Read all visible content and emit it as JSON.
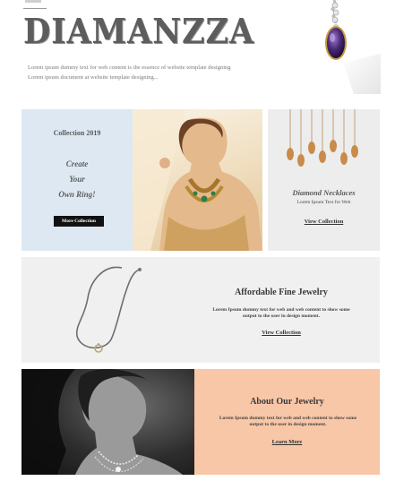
{
  "brand": {
    "logo_text": "DIAMANZZA"
  },
  "intro": {
    "line1": "Lorem ipsum dummy text for web content is the essence of website template designing",
    "line2": "Lorem ipsum document at website template designing..."
  },
  "collection": {
    "title": "Collection 2019",
    "tagline": [
      "Create",
      "Your",
      "Own Ring!"
    ],
    "button_label": "More Collection"
  },
  "necklaces": {
    "title": "Diamond Necklaces",
    "subtitle": "Lorem Ipsum Text for Web",
    "link": "View Collection"
  },
  "affordable": {
    "title": "Affordable Fine Jewelry",
    "body": "Lorem Ipsum dummy text for web and web content to show some output to the user in design moment.",
    "link": "View Collection"
  },
  "about": {
    "title": "About Our Jewelry",
    "body": "Lorem Ipsum dummy text for web and web content to show some output to the user in design moment.",
    "link": "Learn More"
  },
  "colors": {
    "collection_bg": "#dde8f3",
    "necklace_bg": "#ededed",
    "affordable_bg": "#f0f0f0",
    "about_bg": "#f8c7a7",
    "button_bg": "#111111",
    "amethyst": "#4b2a78"
  }
}
